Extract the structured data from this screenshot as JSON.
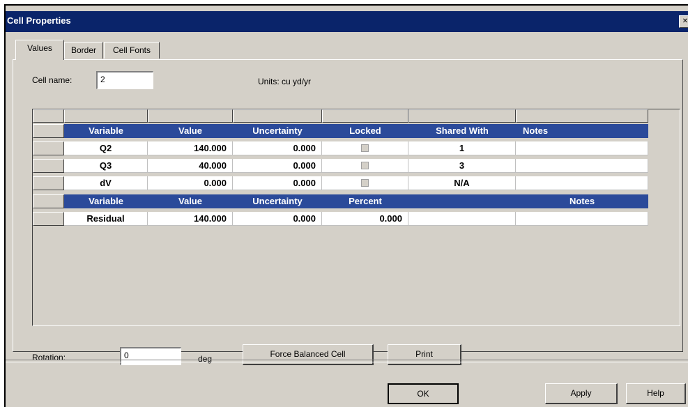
{
  "window": {
    "title": "Cell Properties"
  },
  "tabs": [
    "Values",
    "Border",
    "Cell Fonts"
  ],
  "cell_name": {
    "label": "Cell name:",
    "value": "2"
  },
  "units": "Units: cu yd/yr",
  "table1": {
    "headers": [
      "Variable",
      "Value",
      "Uncertainty",
      "Locked",
      "Shared With",
      "Notes"
    ],
    "rows": [
      {
        "variable": "Q2",
        "value": "140.000",
        "uncertainty": "0.000",
        "locked": false,
        "shared_with": "1",
        "notes": ""
      },
      {
        "variable": "Q3",
        "value": "40.000",
        "uncertainty": "0.000",
        "locked": false,
        "shared_with": "3",
        "notes": ""
      },
      {
        "variable": "dV",
        "value": "0.000",
        "uncertainty": "0.000",
        "locked": false,
        "shared_with": "N/A",
        "notes": ""
      }
    ]
  },
  "table2": {
    "headers": [
      "Variable",
      "Value",
      "Uncertainty",
      "Percent",
      "",
      "Notes"
    ],
    "rows": [
      {
        "variable": "Residual",
        "value": "140.000",
        "uncertainty": "0.000",
        "percent": "0.000",
        "notes": ""
      }
    ]
  },
  "rotation": {
    "label": "Rotation:",
    "value": "0",
    "unit": "deg"
  },
  "buttons": {
    "force_balanced": "Force Balanced Cell",
    "print": "Print",
    "ok": "OK",
    "apply": "Apply",
    "help": "Help"
  },
  "colors": {
    "title_bar": "#0a246a",
    "header_row": "#2b4a9a",
    "window_bg": "#d4d0c8"
  }
}
